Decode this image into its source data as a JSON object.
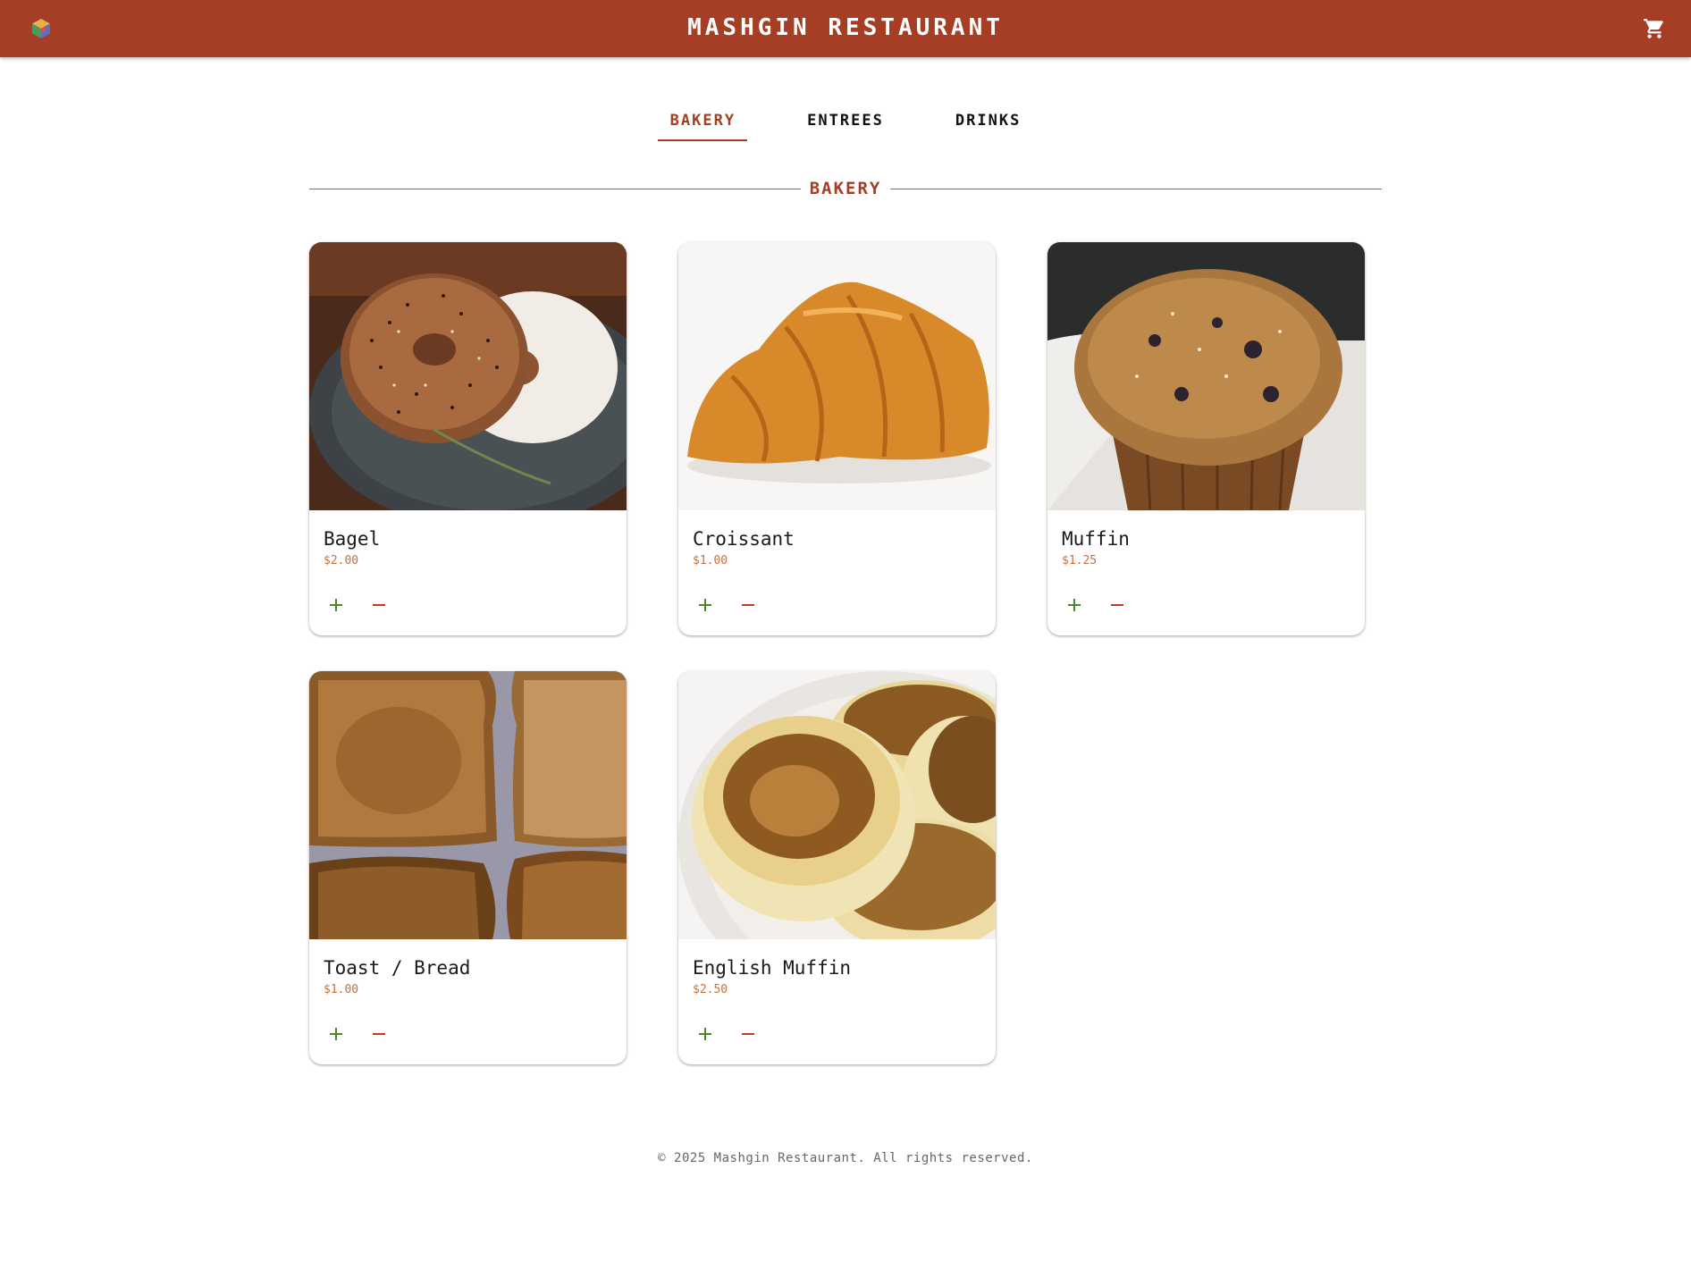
{
  "header": {
    "title": "MASHGIN RESTAURANT",
    "logo_icon": "cube-logo-icon",
    "cart_icon": "shopping-cart-icon",
    "color": "#a53e24"
  },
  "tabs": [
    {
      "label": "BAKERY",
      "active": true
    },
    {
      "label": "ENTREES",
      "active": false
    },
    {
      "label": "DRINKS",
      "active": false
    }
  ],
  "section": {
    "title": "BAKERY"
  },
  "items": [
    {
      "name": "Bagel",
      "price": "$2.00",
      "image": "bagel-photo"
    },
    {
      "name": "Croissant",
      "price": "$1.00",
      "image": "croissant-photo"
    },
    {
      "name": "Muffin",
      "price": "$1.25",
      "image": "muffin-photo"
    },
    {
      "name": "Toast / Bread",
      "price": "$1.00",
      "image": "toast-photo"
    },
    {
      "name": "English Muffin",
      "price": "$2.50",
      "image": "english-muffin-photo"
    }
  ],
  "controls": {
    "add_icon": "plus-icon",
    "remove_icon": "minus-icon",
    "add_color": "#4a8a2a",
    "remove_color": "#c0392b"
  },
  "footer": {
    "text": "© 2025 Mashgin Restaurant. All rights reserved."
  }
}
